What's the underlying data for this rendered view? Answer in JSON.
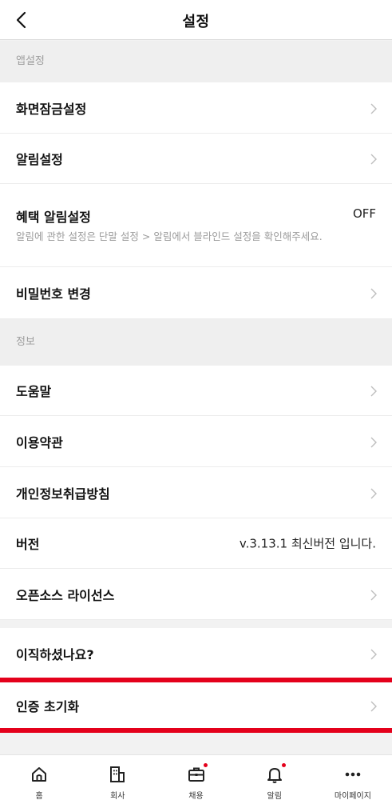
{
  "header": {
    "title": "설정",
    "back_icon": "back-chevron-icon"
  },
  "sections": {
    "app": {
      "title": "앱설정"
    },
    "info": {
      "title": "정보"
    }
  },
  "rows": {
    "screen_lock": {
      "label": "화면잠금설정"
    },
    "notification": {
      "label": "알림설정"
    },
    "benefit": {
      "label": "혜택 알림설정",
      "value": "OFF",
      "description": "알림에 관한 설정은 단말 설정 > 알림에서 블라인드 설정을 확인해주세요."
    },
    "password": {
      "label": "비밀번호 변경"
    },
    "help": {
      "label": "도움말"
    },
    "terms": {
      "label": "이용약관"
    },
    "privacy": {
      "label": "개인정보취급방침"
    },
    "version": {
      "label": "버전",
      "value": "v.3.13.1 최신버전 입니다."
    },
    "opensource": {
      "label": "오픈소스 라이선스"
    },
    "job_change": {
      "label": "이직하셨나요?"
    },
    "reset_auth": {
      "label": "인증 초기화"
    }
  },
  "bottom_nav": [
    {
      "label": "홈",
      "icon": "home-icon"
    },
    {
      "label": "회사",
      "icon": "company-building-icon"
    },
    {
      "label": "채용",
      "icon": "briefcase-icon"
    },
    {
      "label": "알림",
      "icon": "bell-icon"
    },
    {
      "label": "마이페이지",
      "icon": "more-dots-icon"
    }
  ],
  "colors": {
    "highlight_red": "#e4001b",
    "section_bg": "#efefef",
    "section_text": "#9d9d9d"
  }
}
